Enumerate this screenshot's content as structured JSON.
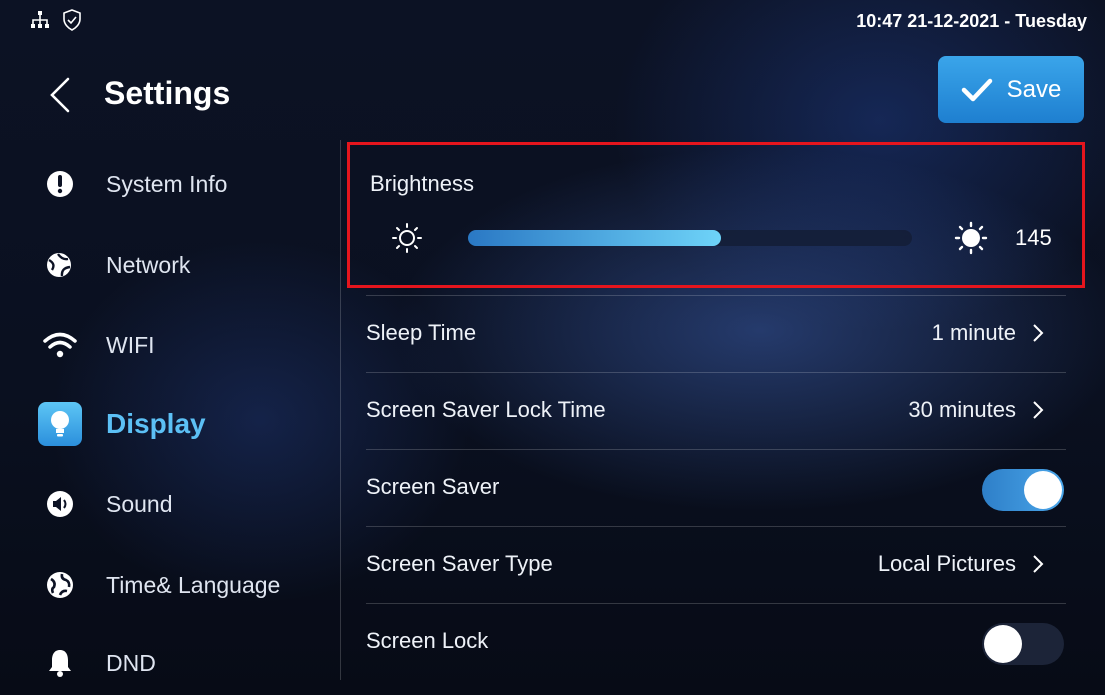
{
  "status": {
    "clock": "10:47  21-12-2021 - Tuesday",
    "icons": [
      "network-topology-icon",
      "shield-check-icon"
    ]
  },
  "header": {
    "title": "Settings",
    "save_label": "Save"
  },
  "sidebar": {
    "items": [
      {
        "label": "System Info",
        "icon": "info-circle-icon"
      },
      {
        "label": "Network",
        "icon": "network-globe-icon"
      },
      {
        "label": "WIFI",
        "icon": "wifi-icon"
      },
      {
        "label": "Display",
        "icon": "bulb-icon",
        "active": true
      },
      {
        "label": "Sound",
        "icon": "speaker-icon"
      },
      {
        "label": "Time& Language",
        "icon": "globe-icon"
      },
      {
        "label": "DND",
        "icon": "bell-icon"
      }
    ]
  },
  "brightness": {
    "label": "Brightness",
    "value": "145",
    "level_fraction": 0.57
  },
  "settings": {
    "sleep_time": {
      "label": "Sleep Time",
      "value": "1 minute"
    },
    "saver_lock_time": {
      "label": "Screen Saver Lock Time",
      "value": "30 minutes"
    },
    "screen_saver": {
      "label": "Screen Saver",
      "on": true
    },
    "saver_type": {
      "label": "Screen Saver Type",
      "value": "Local Pictures"
    },
    "screen_lock": {
      "label": "Screen Lock",
      "on": false
    }
  },
  "colors": {
    "accent": "#5cc0f5",
    "save_button": "#2a90dc",
    "highlight_box": "#e5151d"
  }
}
